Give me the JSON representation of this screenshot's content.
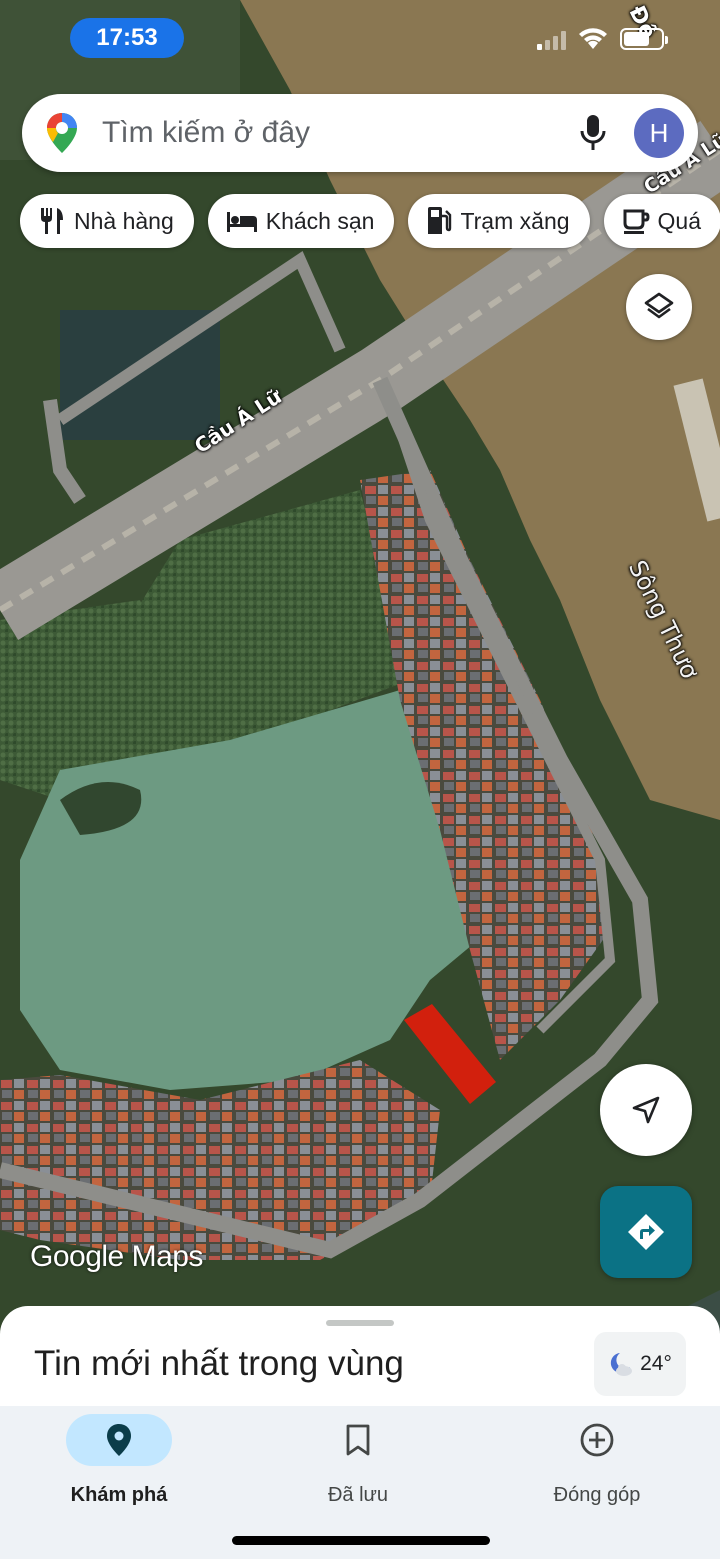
{
  "status_bar": {
    "time": "17:53",
    "battery_level": 0.7
  },
  "search": {
    "placeholder": "Tìm kiếm ở đây",
    "avatar_initial": "H"
  },
  "chips": [
    {
      "label": "Nhà hàng",
      "icon": "restaurant-icon"
    },
    {
      "label": "Khách sạn",
      "icon": "hotel-icon"
    },
    {
      "label": "Trạm xăng",
      "icon": "gas-station-icon"
    },
    {
      "label": "Quá",
      "icon": "coffee-icon"
    }
  ],
  "map": {
    "labels": {
      "bridge": "Cầu Á Lữ",
      "bridge_top": "Cầu Á Lữ",
      "river": "Sông Thươ",
      "corner": "Đê"
    },
    "watermark": "Google Maps",
    "colors": {
      "river": "#8a7752",
      "lake": "#6d9a82",
      "roads": "#8e8e8a",
      "highlight": "#e31c0a"
    }
  },
  "sheet": {
    "title": "Tin mới nhất trong vùng",
    "temperature": "24°"
  },
  "nav": [
    {
      "label": "Khám phá",
      "icon": "location-pin-icon",
      "active": true
    },
    {
      "label": "Đã lưu",
      "icon": "bookmark-icon",
      "active": false
    },
    {
      "label": "Đóng góp",
      "icon": "add-circle-icon",
      "active": false
    }
  ],
  "accent_color": "#1a73e8"
}
